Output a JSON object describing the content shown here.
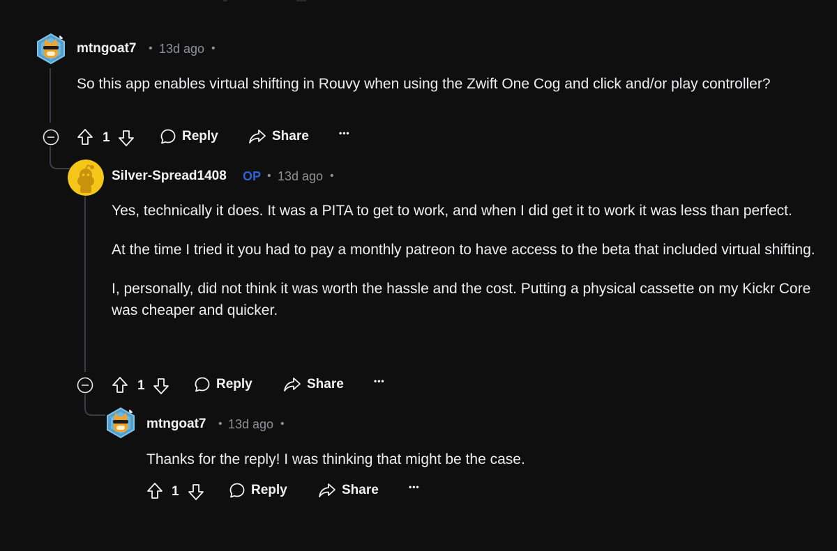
{
  "comments": [
    {
      "username": "mtngoat7",
      "time": "13d ago",
      "op_badge": "",
      "paragraphs": [
        "So this app enables virtual shifting in Rouvy when using the Zwift One Cog and click and/or play controller?"
      ],
      "votes": "1",
      "reply_label": "Reply",
      "share_label": "Share",
      "more_label": "•••"
    },
    {
      "username": "Silver-Spread1408",
      "op_badge": "OP",
      "time": "13d ago",
      "paragraphs": [
        "Yes, technically it does. It was a PITA to get to work, and when I did get it to work it was less than perfect.",
        "At the time I tried it you had to pay a monthly patreon to have access to the beta that included virtual shifting.",
        "I, personally, did not think it was worth the hassle and the cost. Putting a physical cassette on my Kickr Core was cheaper and quicker."
      ],
      "votes": "1",
      "reply_label": "Reply",
      "share_label": "Share",
      "more_label": "•••"
    },
    {
      "username": "mtngoat7",
      "time": "13d ago",
      "op_badge": "",
      "paragraphs": [
        "Thanks for the reply! I was thinking that might be the case."
      ],
      "votes": "1",
      "reply_label": "Reply",
      "share_label": "Share",
      "more_label": "•••"
    }
  ],
  "separator": "•",
  "colors": {
    "background": "#0f0f10",
    "text": "#eeeef0",
    "meta": "#8e9196",
    "op_badge": "#2a63d6",
    "thread_line": "#3b3d42",
    "avatar_cat_bg": "#5ba3c7",
    "avatar_snoo_bg": "#f5c518"
  },
  "icons": {
    "collapse": "collapse-minus-icon",
    "upvote": "upvote-arrow-icon",
    "downvote": "downvote-arrow-icon",
    "reply": "speech-bubble-icon",
    "share": "share-arrow-icon",
    "more": "more-dots-icon",
    "avatar_1": "cat-avatar-icon",
    "avatar_2": "snoo-avatar-icon"
  }
}
